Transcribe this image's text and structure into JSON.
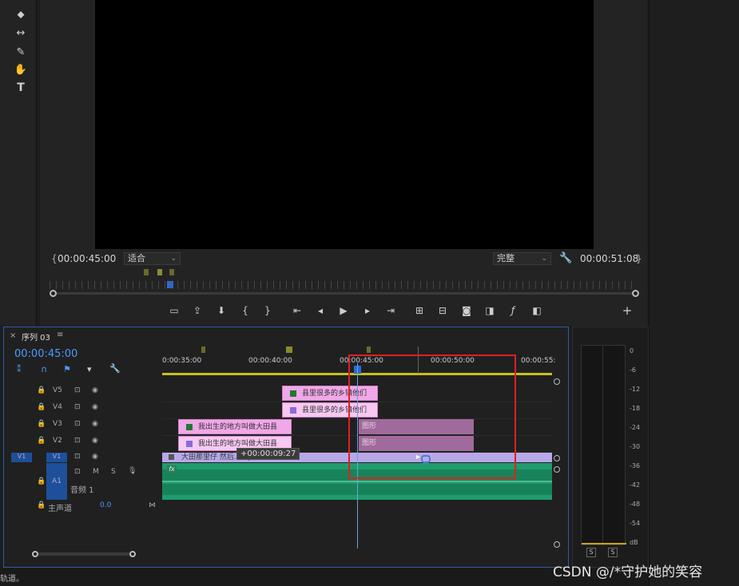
{
  "program_monitor": {
    "timecode_in": "00:00:45:00",
    "fit_select": "适合",
    "quality_select": "完整",
    "timecode_total": "00:00:51:08"
  },
  "timeline": {
    "tab_close": "×",
    "tab_title": "序列 03",
    "tab_menu": "≡",
    "current_timecode": "00:00:45:00",
    "ruler_labels": [
      "0:00:35:00",
      "00:00:40:00",
      "00:00:45:00",
      "00:00:50:00",
      "00:00:55:"
    ],
    "tracks": {
      "v5": "V5",
      "v4": "V4",
      "v3": "V3",
      "v2": "V2",
      "v1_src": "V1",
      "v1": "V1",
      "a1": "A1",
      "a1_m": "M",
      "a1_s": "S",
      "a1_name": "音频 1",
      "master_label": "主声道",
      "master_value": "0.0"
    },
    "clips": {
      "v5_clip": "县里很多的乡镇他们",
      "v4_clip": "县里很多的乡镇他们",
      "v3_clip": "我出生的地方叫做大田县",
      "v2_clip": "我出生的地方叫做大田县",
      "v3_shape": "图形",
      "v2_shape": "图形",
      "v1_clip": "大田那里仔 然后...mp4",
      "a1_fx": "fx"
    },
    "tooltip": "+00:00:09:27"
  },
  "meter": {
    "scale": [
      "0",
      "-6",
      "-12",
      "-18",
      "-24",
      "-30",
      "-36",
      "-42",
      "-48",
      "-54",
      "dB"
    ],
    "solo_left": "S",
    "solo_right": "S"
  },
  "status_text": "轨道。",
  "watermark": "CSDN @/*守护她的笑容",
  "colors": {
    "accent": "#2a5fa8",
    "pink_clip": "#f0a8e8",
    "shape_clip": "#a06a9c",
    "audio_clip": "#1f9c6e",
    "video_clip": "#b8a8e8",
    "highlight_box": "#e02020",
    "timecode_blue": "#4a9cff"
  }
}
